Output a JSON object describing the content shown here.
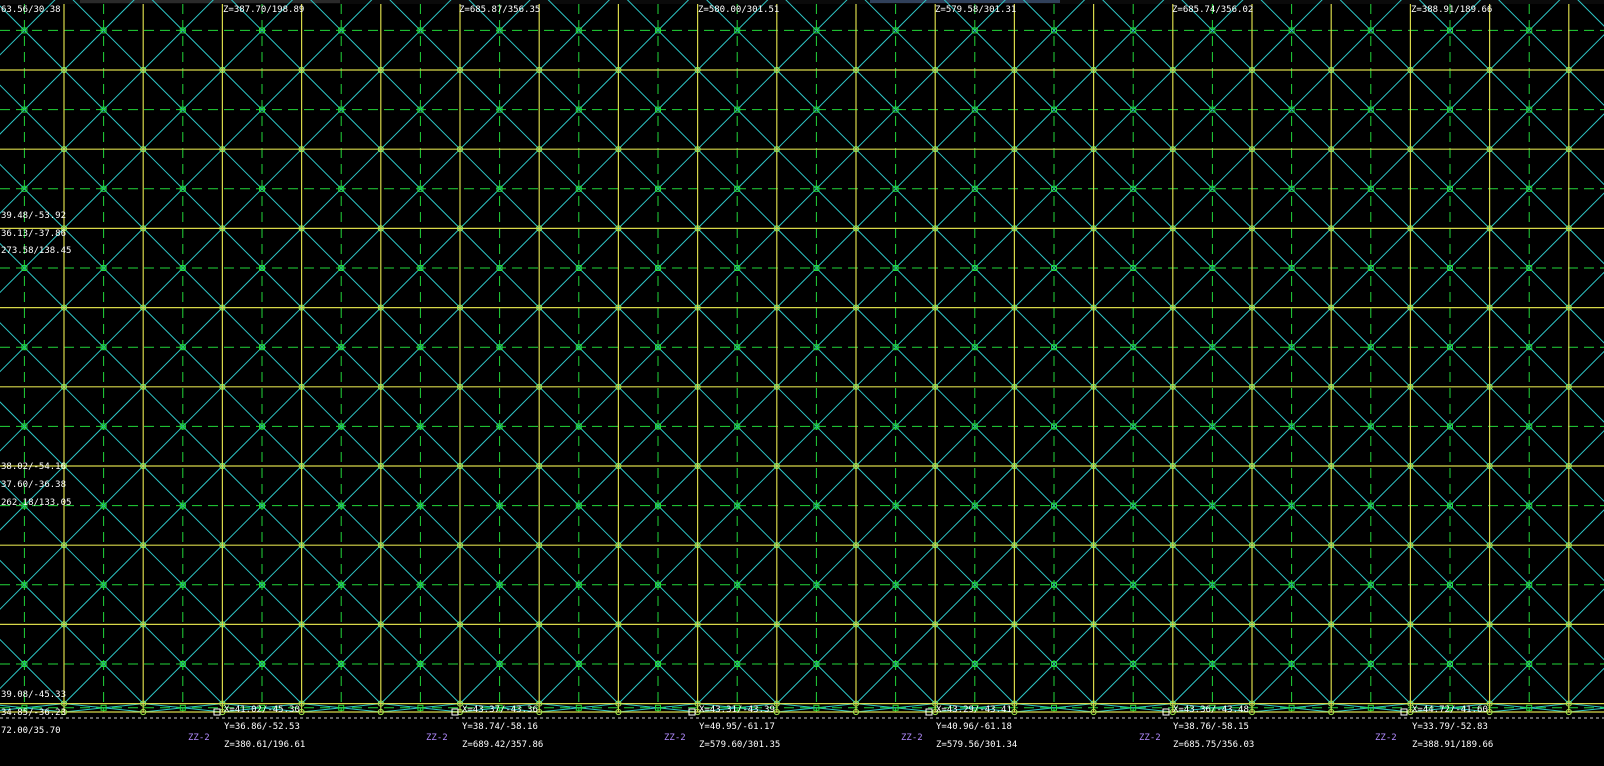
{
  "colors": {
    "background": "#000000",
    "primary_grid": "#d8d84a",
    "diagonal": "#2fc7c7",
    "secondary_grid": "#22d63a",
    "node": "#9ce64a",
    "text": "#ffffff",
    "tag": "#b38cff",
    "edge_line": "#cfcfcf"
  },
  "top_labels": [
    "63.56/30.38",
    "Z=387.70/198.89",
    "Z=685.87/356.35",
    "Z=580.00/301.51",
    "Z=579.58/301.31",
    "Z=685.74/356.02",
    "Z=388.91/189.66"
  ],
  "left_labels": {
    "group1": [
      "39.48/-53.92",
      "36.13/-37.86",
      "273.58/138.45"
    ],
    "group2": [
      "38.02/-54.16",
      "37.60/-36.38",
      "262.18/133.05"
    ],
    "group3": [
      "39.08/-45.33",
      "34.85/-36.23",
      "72.00/35.70"
    ]
  },
  "bottom_support_labels": [
    {
      "x": "X=41.02/-45.30",
      "y": "Y=36.86/-52.53",
      "z": "Z=380.61/196.61"
    },
    {
      "x": "X=43.37/-43.36",
      "y": "Y=38.74/-58.16",
      "z": "Z=689.42/357.86"
    },
    {
      "x": "X=43.31/-43.39",
      "y": "Y=40.95/-61.17",
      "z": "Z=579.60/301.35"
    },
    {
      "x": "X=43.29/-43.41",
      "y": "Y=40.96/-61.18",
      "z": "Z=579.56/301.34"
    },
    {
      "x": "X=43.36/-43.48",
      "y": "Y=38.76/-58.15",
      "z": "Z=685.75/356.03"
    },
    {
      "x": "X=44.72/-41.60",
      "y": "Y=33.79/-52.83",
      "z": "Z=388.91/189.66"
    }
  ],
  "zz_tags": [
    "ZZ-2",
    "ZZ-2",
    "ZZ-2",
    "ZZ-2",
    "ZZ-2",
    "ZZ-2"
  ]
}
